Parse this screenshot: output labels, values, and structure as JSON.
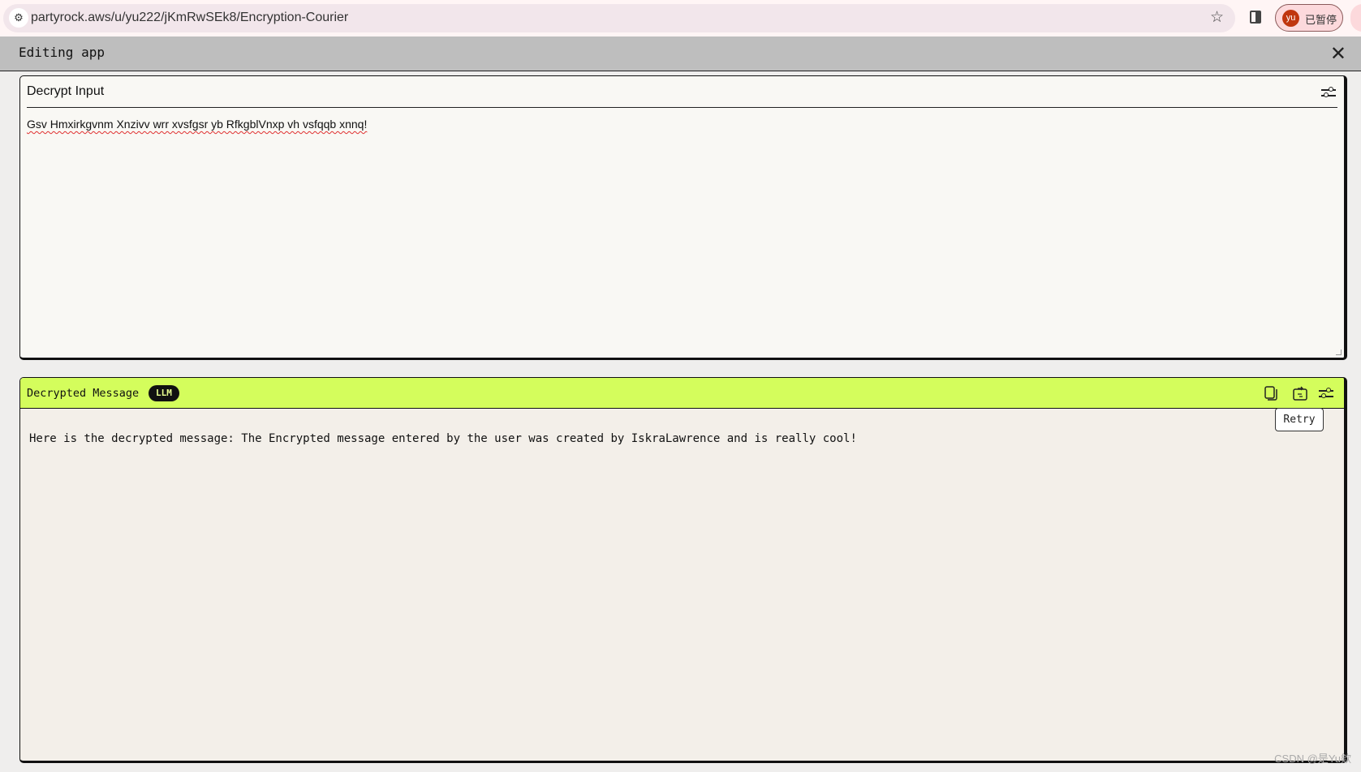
{
  "browser": {
    "url": "partyrock.aws/u/yu222/jKmRwSEk8/Encryption-Courier",
    "profile_initials": "yu",
    "profile_status": "已暂停",
    "icons": [
      "site-settings-icon",
      "bookmark-star-icon",
      "side-panel-icon"
    ]
  },
  "editor": {
    "title": "Editing app",
    "close_icon": "close-icon"
  },
  "widgets": [
    {
      "title": "Decrypt Input",
      "value": "Gsv Hmxirkgvnm Xnzivv wrr xvsfgsr yb RfkgblVnxp vh vsfqqb xnnq!"
    },
    {
      "title": "Decrypted Message",
      "badge": "LLM",
      "accent": "#d4fd5c",
      "output": "Here is the decrypted message: The Encrypted message entered by the user was created by IskraLawrence and is really cool!",
      "tooltip": "Retry"
    }
  ],
  "watermark": "CSDN @是Yu欸"
}
